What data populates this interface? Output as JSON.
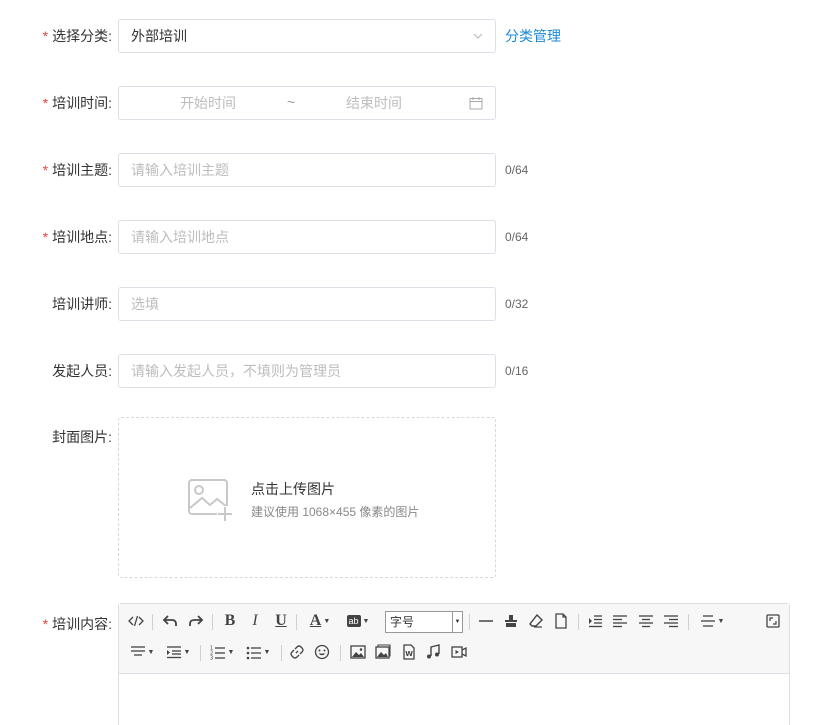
{
  "form": {
    "category": {
      "label": "选择分类:",
      "value": "外部培训",
      "manage_link": "分类管理"
    },
    "time": {
      "label": "培训时间:",
      "start_placeholder": "开始时间",
      "separator": "~",
      "end_placeholder": "结束时间"
    },
    "topic": {
      "label": "培训主题:",
      "placeholder": "请输入培训主题",
      "counter": "0/64"
    },
    "location": {
      "label": "培训地点:",
      "placeholder": "请输入培训地点",
      "counter": "0/64"
    },
    "lecturer": {
      "label": "培训讲师:",
      "placeholder": "选填",
      "counter": "0/32"
    },
    "initiator": {
      "label": "发起人员:",
      "placeholder": "请输入发起人员，不填则为管理员",
      "counter": "0/16"
    },
    "cover": {
      "label": "封面图片:",
      "upload_title": "点击上传图片",
      "upload_hint": "建议使用 1068×455 像素的图片"
    },
    "content": {
      "label": "培训内容:",
      "font_size_placeholder": "字号"
    }
  },
  "required_mark": "*",
  "colors": {
    "accent": "#1a8ad8",
    "required": "#e8453c",
    "border": "#dcdfe6"
  }
}
